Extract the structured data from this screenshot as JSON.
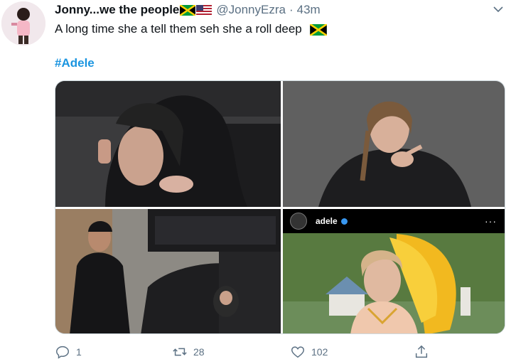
{
  "tweet": {
    "author_name": "Jonny...we the people",
    "handle": "@JonnyEzra",
    "separator": "·",
    "time": "43m",
    "text": "A long time she a tell them seh she a roll deep",
    "hashtag": "#Adele",
    "icons": {
      "more": "chevron-down-icon",
      "flag1": "jamaica-flag-icon",
      "flag2": "us-flag-icon"
    }
  },
  "media": {
    "instagram": {
      "username": "adele",
      "more": "···"
    }
  },
  "actions": {
    "reply": {
      "icon": "reply-icon",
      "count": "1"
    },
    "retweet": {
      "icon": "retweet-icon",
      "count": "28"
    },
    "like": {
      "icon": "heart-icon",
      "count": "102"
    },
    "share": {
      "icon": "share-icon"
    }
  },
  "colors": {
    "hashtag": "#1b95e0",
    "muted": "#5b7083",
    "border": "#cfd9de"
  }
}
